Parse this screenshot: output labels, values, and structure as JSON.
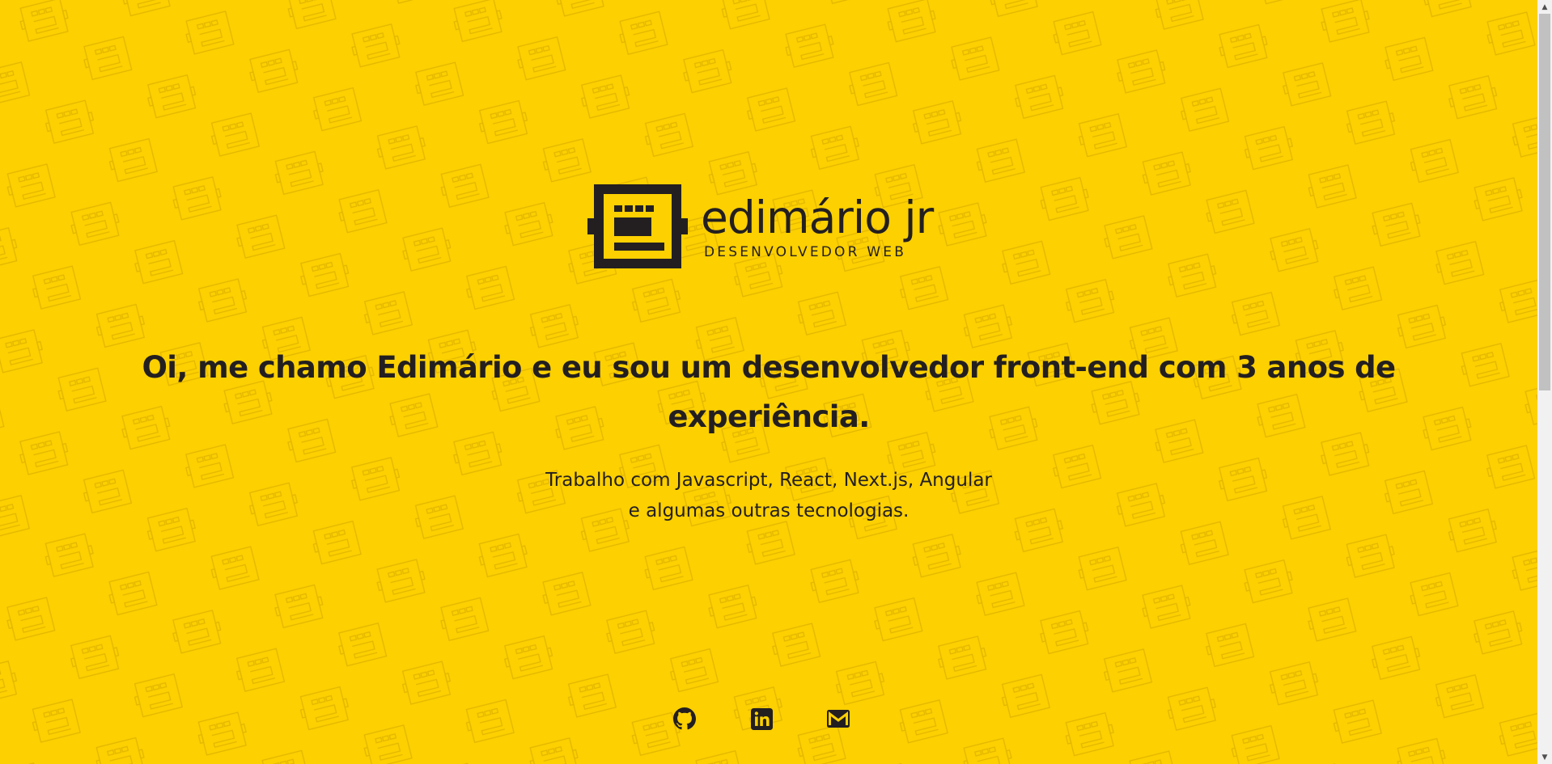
{
  "colors": {
    "background": "#fcd001",
    "pattern_stroke": "#e3b600",
    "text": "#231f20"
  },
  "logo": {
    "name": "edimário jr",
    "tagline": "DESENVOLVEDOR WEB",
    "mark_icon": "e-robot-logo-icon"
  },
  "hero": {
    "headline": "Oi, me chamo Edimário e eu sou um desenvolvedor front-end com 3 anos de experiência.",
    "subtitle_line1": "Trabalho com Javascript, React, Next.js, Angular",
    "subtitle_line2": "e algumas outras tecnologias."
  },
  "socials": [
    {
      "name": "GitHub",
      "icon": "github-icon"
    },
    {
      "name": "LinkedIn",
      "icon": "linkedin-icon"
    },
    {
      "name": "Email",
      "icon": "mail-icon"
    }
  ],
  "scrollbar": {
    "up_icon": "▲",
    "down_icon": "▼"
  }
}
